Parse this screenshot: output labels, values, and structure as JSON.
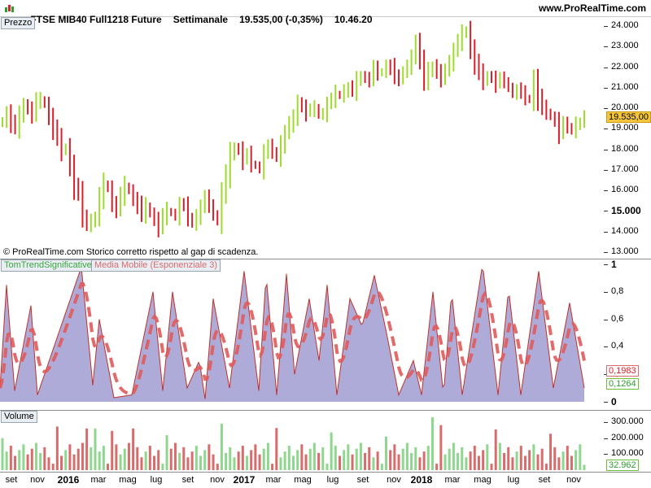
{
  "header": {
    "instrument": "FTSE MIB40 Full1218 Future",
    "period": "Settimanale",
    "last_price": "19.535,00 (-0,35%)",
    "time": "10.46.20",
    "site": "www.ProRealTime.com"
  },
  "price_pane": {
    "label": "Prezzo",
    "copyright": "© ProRealTime.com  Storico corretto rispetto al gap di scadenza.",
    "axis_labels": [
      "24.000",
      "23.000",
      "22.000",
      "21.000",
      "20.000",
      "19.000",
      "18.000",
      "17.000",
      "16.000",
      "15.000",
      "14.000",
      "13.000"
    ],
    "highlight_15000": "15.000",
    "current_tag": "19.535,00",
    "colors": {
      "up": "#9ddc2c",
      "down": "#d8202c",
      "tag_bg": "#f5c63b"
    }
  },
  "indicator_pane": {
    "label_a": "TomTrendSignificative",
    "label_b": "Media Mobile (Esponenziale 3)",
    "axis_labels": [
      "1",
      "0,8",
      "0,6",
      "0,4",
      "0",
      "0,2"
    ],
    "tag_ma": "0,1983",
    "tag_trend": "0,1264",
    "colors": {
      "fill": "#aeabd8",
      "line": "#6cbf3a",
      "ma": "#e05a5a"
    }
  },
  "volume_pane": {
    "label": "Volume",
    "axis_labels": [
      "300.000",
      "200.000",
      "100.000"
    ],
    "current_tag": "32.962",
    "colors": {
      "up": "#8fd68f",
      "down": "#d86c6c"
    }
  },
  "time_axis": [
    {
      "label": "set",
      "year": false
    },
    {
      "label": "nov",
      "year": false
    },
    {
      "label": "2016",
      "year": true
    },
    {
      "label": "mar",
      "year": false
    },
    {
      "label": "mag",
      "year": false
    },
    {
      "label": "lug",
      "year": false
    },
    {
      "label": "set",
      "year": false
    },
    {
      "label": "nov",
      "year": false
    },
    {
      "label": "2017",
      "year": true
    },
    {
      "label": "mar",
      "year": false
    },
    {
      "label": "mag",
      "year": false
    },
    {
      "label": "lug",
      "year": false
    },
    {
      "label": "set",
      "year": false
    },
    {
      "label": "nov",
      "year": false
    },
    {
      "label": "2018",
      "year": true
    },
    {
      "label": "mar",
      "year": false
    },
    {
      "label": "mag",
      "year": false
    },
    {
      "label": "lug",
      "year": false
    },
    {
      "label": "set",
      "year": false
    },
    {
      "label": "nov",
      "year": false
    }
  ],
  "chart_data": [
    {
      "type": "ohlc",
      "title": "FTSE MIB40 Full1218 Future",
      "ylim": [
        12700,
        24400
      ],
      "close_series": [
        19400,
        19800,
        19300,
        19000,
        19600,
        20200,
        20000,
        19700,
        20300,
        20400,
        20200,
        19600,
        19000,
        18500,
        17900,
        18100,
        17200,
        16200,
        15800,
        14800,
        14300,
        14600,
        14700,
        15600,
        16300,
        16100,
        15400,
        15100,
        15700,
        16200,
        16000,
        15600,
        15300,
        14800,
        15200,
        14900,
        14600,
        14200,
        14700,
        15000,
        14900,
        14800,
        15300,
        15200,
        14700,
        14400,
        14800,
        15200,
        15600,
        15300,
        14800,
        14600,
        15800,
        16700,
        17700,
        18100,
        18000,
        17500,
        17700,
        17300,
        17200,
        17100,
        17800,
        18100,
        17900,
        17600,
        18300,
        18800,
        19200,
        19500,
        20300,
        20100,
        19800,
        19900,
        20000,
        19700,
        19800,
        20200,
        20400,
        20700,
        20600,
        20900,
        21000,
        20800,
        21300,
        21600,
        21500,
        21400,
        21900,
        21700,
        21800,
        22100,
        22000,
        21500,
        21400,
        21800,
        22100,
        22500,
        23100,
        22400,
        21300,
        21900,
        22000,
        21700,
        21400,
        21900,
        22300,
        22800,
        23200,
        23600,
        23800,
        22900,
        22200,
        21700,
        21300,
        21600,
        21500,
        21200,
        21400,
        21300,
        21000,
        20800,
        20900,
        20700,
        20500,
        20400,
        21400,
        20500,
        20000,
        19800,
        19600,
        19400,
        18800,
        19200,
        19100,
        18900,
        19300,
        19300,
        19535
      ],
      "colors_note": "green = up week, red = down week"
    },
    {
      "type": "area",
      "series": [
        {
          "name": "TomTrendSignificative",
          "range": [
            0,
            1
          ]
        },
        {
          "name": "Media Mobile (Esponenziale 3)",
          "range": [
            0,
            1
          ]
        }
      ],
      "ylim": [
        0,
        1
      ],
      "last_values": {
        "TomTrendSignificative": 0.1264,
        "Media Mobile (Esponenziale 3)": 0.1983
      }
    },
    {
      "type": "bar",
      "title": "Volume",
      "ylim": [
        0,
        360000
      ],
      "last_value": 32962
    }
  ]
}
